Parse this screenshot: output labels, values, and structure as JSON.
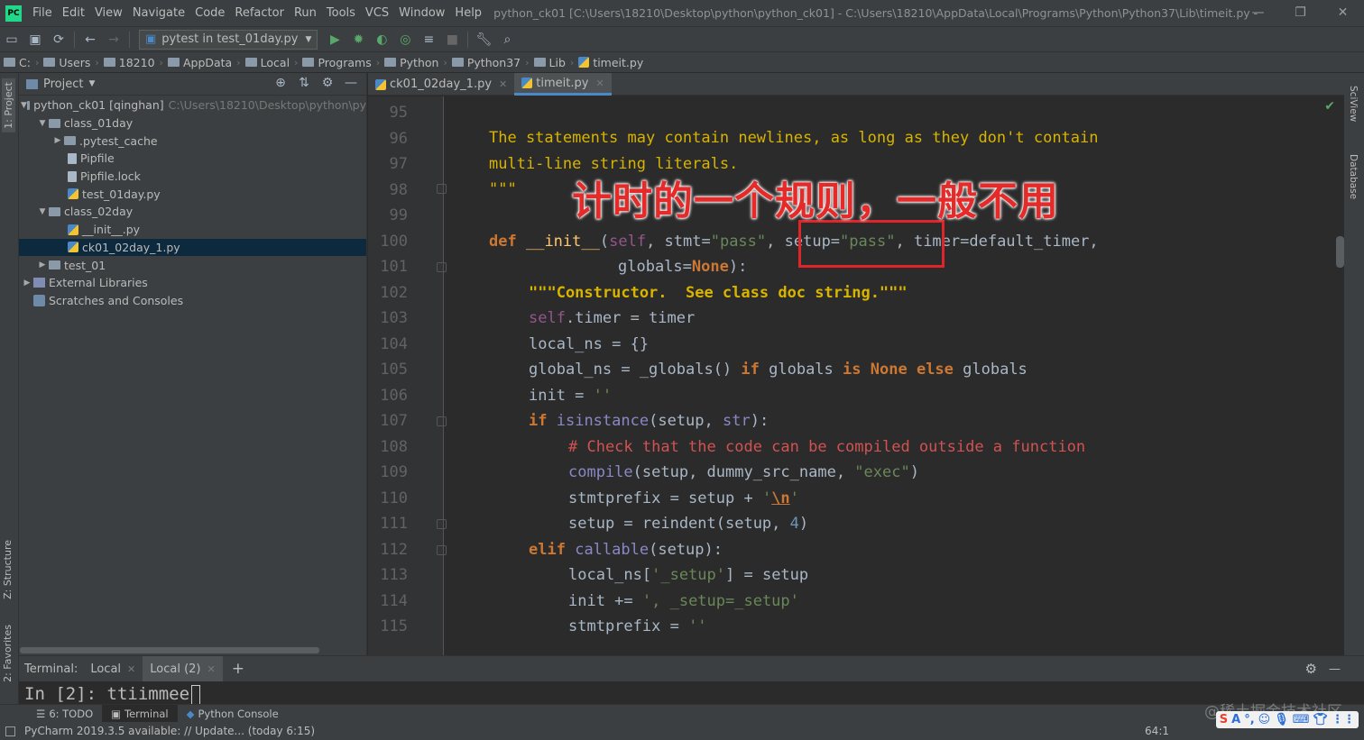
{
  "app": {
    "logo_text": "PC",
    "menu": [
      "File",
      "Edit",
      "View",
      "Navigate",
      "Code",
      "Refactor",
      "Run",
      "Tools",
      "VCS",
      "Window",
      "Help"
    ],
    "window_title": "python_ck01 [C:\\Users\\18210\\Desktop\\python\\python_ck01] - C:\\Users\\18210\\AppData\\Local\\Programs\\Python\\Python37\\Lib\\timeit.py - PyCharm"
  },
  "toolbar": {
    "run_config": "pytest in test_01day.py"
  },
  "breadcrumbs": [
    "C:",
    "Users",
    "18210",
    "AppData",
    "Local",
    "Programs",
    "Python",
    "Python37",
    "Lib",
    "timeit.py"
  ],
  "left_strip": {
    "project": "1: Project",
    "structure": "Z: Structure",
    "favorites": "2: Favorites"
  },
  "right_strip": {
    "sciview": "SciView",
    "database": "Database"
  },
  "project_panel": {
    "title": "Project",
    "tree": [
      {
        "label": "python_ck01 [qinghan]",
        "path": "C:\\Users\\18210\\Desktop\\python\\py"
      },
      {
        "label": "class_01day"
      },
      {
        "label": ".pytest_cache"
      },
      {
        "label": "Pipfile"
      },
      {
        "label": "Pipfile.lock"
      },
      {
        "label": "test_01day.py"
      },
      {
        "label": "class_02day"
      },
      {
        "label": "__init__.py"
      },
      {
        "label": "ck01_02day_1.py"
      },
      {
        "label": "test_01"
      },
      {
        "label": "External Libraries"
      },
      {
        "label": "Scratches and Consoles"
      }
    ]
  },
  "editor": {
    "tabs": [
      "ck01_02day_1.py",
      "timeit.py"
    ],
    "line_numbers": [
      "95",
      "96",
      "97",
      "98",
      "99",
      "100",
      "101",
      "102",
      "103",
      "104",
      "105",
      "106",
      "107",
      "108",
      "109",
      "110",
      "111",
      "112",
      "113",
      "114",
      "115"
    ],
    "overlay_text": "计时的一个规则，一般不用",
    "code": {
      "l96": "The statements may contain newlines, as long as they don't contain",
      "l97": "multi-line string literals.",
      "l98": "\"\"\"",
      "l100": [
        "def",
        "__init__",
        "(",
        "self",
        ", stmt=",
        "\"pass\"",
        ", ",
        "setup=",
        "\"pass\"",
        ", ",
        "timer=default_timer,"
      ],
      "l101": [
        "globals=",
        "None",
        "):"
      ],
      "l102": "\"\"\"Constructor.  See class doc string.\"\"\"",
      "l103": [
        "self",
        ".timer = timer"
      ],
      "l104": "local_ns = {}",
      "l105": [
        "global_ns = _globals() ",
        "if",
        " globals ",
        "is",
        " ",
        "None",
        " ",
        "else",
        " globals"
      ],
      "l106": [
        "init = ",
        "''"
      ],
      "l107": [
        "if",
        " ",
        "isinstance",
        "(setup, ",
        "str",
        "):"
      ],
      "l108": "# Check that the code can be compiled outside a function",
      "l109": [
        "compile",
        "(setup, dummy_src_name, ",
        "\"exec\"",
        ")"
      ],
      "l110": [
        "stmtprefix = setup + ",
        "'",
        "\\n",
        "'"
      ],
      "l111": [
        "setup = reindent(setup, ",
        "4",
        ")"
      ],
      "l112": [
        "elif",
        " ",
        "callable",
        "(setup):"
      ],
      "l113": [
        "local_ns[",
        "'_setup'",
        "] = setup"
      ],
      "l114": [
        "init += ",
        "', _setup=_setup'"
      ],
      "l115": [
        "stmtprefix = ",
        "''"
      ]
    }
  },
  "terminal": {
    "label": "Terminal:",
    "tabs": [
      "Local",
      "Local (2)"
    ],
    "add": "+",
    "line": "In [2]: ttiimmee"
  },
  "tool_windows": [
    "6: TODO",
    "Terminal",
    "Python Console"
  ],
  "status": {
    "message": "PyCharm 2019.3.5 available: // Update... (today 6:15)",
    "position": "64:1"
  },
  "watermark": "@稀土掘金技术社区",
  "colors": {
    "accent": "#4a88c7",
    "highlight_box": "#e0252a",
    "overlay_text": "#e52a2a"
  }
}
